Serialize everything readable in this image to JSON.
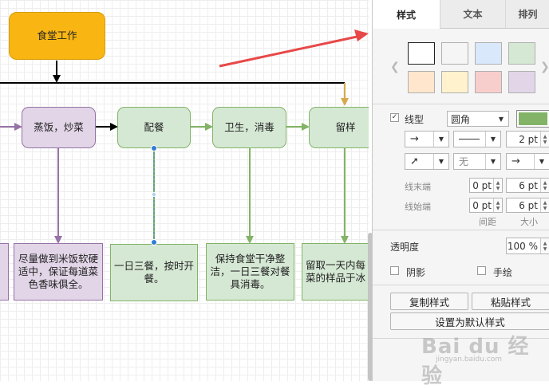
{
  "diagram": {
    "start_node": "食堂工作",
    "steps": [
      "蒸饭，炒菜",
      "配餐",
      "卫生，消毒",
      "留样"
    ],
    "notes": [
      "尽量做到米饭软硬适中，保证每道菜色香味俱全。",
      "一日三餐，按时开餐。",
      "保持食堂干净整洁，一日三餐对餐具消毒。",
      "留取一天内每菜的样品于冰"
    ]
  },
  "panel": {
    "tabs": [
      "样式",
      "文本",
      "排列"
    ],
    "line": {
      "checkbox_label": "线型",
      "checked": true,
      "style_value": "圆角",
      "line_color": "#82b366",
      "width_value": "2 pt",
      "waypoint_value": "无"
    },
    "ends": {
      "line_end_label": "线末端",
      "line_start_label": "线始端",
      "end_spacing": "0 pt",
      "end_size": "6 pt",
      "start_spacing": "0 pt",
      "start_size": "6 pt",
      "spacing_label": "间距",
      "size_label": "大小"
    },
    "opacity": {
      "label": "透明度",
      "value": "100 %"
    },
    "shadow_label": "阴影",
    "sketch_label": "手绘",
    "copy_style": "复制样式",
    "paste_style": "粘贴样式",
    "set_default_style": "设置为默认样式"
  },
  "swatch_colors": [
    "#ffffff",
    "#f5f5f5",
    "#dae8fc",
    "#d5e8d4",
    "#ffe6cc",
    "#fff2cc",
    "#f8cecc",
    "#e1d5e7"
  ],
  "watermark": {
    "main": "Bai du 经验",
    "sub": "jingyan.baidu.com"
  }
}
